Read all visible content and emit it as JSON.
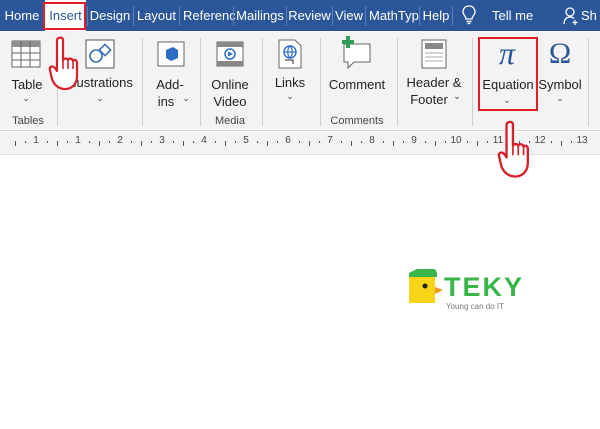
{
  "tabs": [
    {
      "label": "Home",
      "active": false
    },
    {
      "label": "Insert",
      "active": true
    },
    {
      "label": "Design",
      "active": false
    },
    {
      "label": "Layout",
      "active": false
    },
    {
      "label": "Referenc",
      "active": false
    },
    {
      "label": "Mailings",
      "active": false
    },
    {
      "label": "Review",
      "active": false
    },
    {
      "label": "View",
      "active": false
    },
    {
      "label": "MathTyp",
      "active": false
    },
    {
      "label": "Help",
      "active": false
    }
  ],
  "tell_me": "Tell me",
  "share_label": "Sh",
  "ribbon": {
    "table": "Table",
    "illustrations": "Illustrations",
    "addins_line1": "Add-",
    "addins_line2": "ins",
    "online_video_line1": "Online",
    "online_video_line2": "Video",
    "links": "Links",
    "comment": "Comment",
    "header_footer_line1": "Header &",
    "header_footer_line2": "Footer",
    "equation_symbol": "π",
    "equation": "Equation",
    "symbol_glyph": "Ω",
    "symbol": "Symbol"
  },
  "groups": {
    "tables": "Tables",
    "media": "Media",
    "comments": "Comments"
  },
  "ruler_numbers": [
    "1",
    "1",
    "2",
    "3",
    "4",
    "5",
    "6",
    "7",
    "8",
    "9",
    "10",
    "11",
    "12",
    "13"
  ],
  "logo": {
    "name": "TEKY",
    "tagline": "Young can do IT"
  },
  "colors": {
    "accent": "#2b579a",
    "highlight": "#e21d2a",
    "logo_green": "#3ab54a",
    "logo_yellow": "#f7d417"
  }
}
